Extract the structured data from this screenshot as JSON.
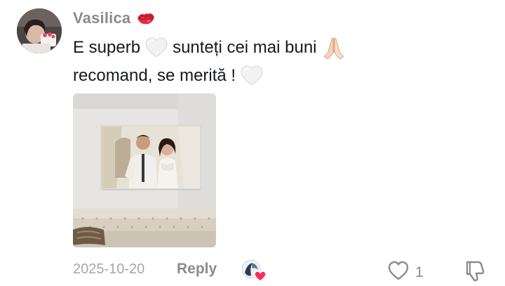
{
  "comment": {
    "username": "Vasilica",
    "username_emoji": "kiss-mark-icon",
    "text_line1_a": "E superb",
    "text_line1_b": "sunteți cei mai buni",
    "text_line2": "recomand, se merită !",
    "emojis": [
      "white-heart-icon",
      "folded-hands-icon",
      "white-heart-icon"
    ],
    "date": "2025-10-20",
    "reply_label": "Reply",
    "like_count": "1",
    "liked_by_author": true,
    "colors": {
      "username": "#8a8b91",
      "text": "#161823",
      "meta": "#a6a7ab",
      "liked_heart": "#fe2c55"
    }
  }
}
